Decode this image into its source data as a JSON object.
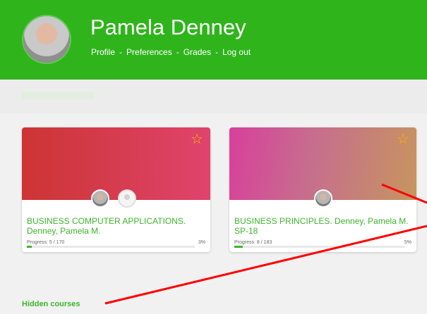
{
  "user": {
    "name": "Pamela Denney",
    "nav": [
      "Profile",
      "Preferences",
      "Grades",
      "Log out"
    ],
    "nav_separator": "-"
  },
  "courses": [
    {
      "title": "BUSINESS COMPUTER APPLICATIONS. Denney, Pamela M.",
      "progress_label": "Progress: 5 / 170",
      "progress_percent_text": "3%",
      "progress_fraction": 0.03,
      "banner_colors": [
        "#cd3434",
        "#e0436d"
      ]
    },
    {
      "title": "BUSINESS PRINCIPLES. Denney, Pamela M. SP-18",
      "progress_label": "Progress: 8 / 183",
      "progress_percent_text": "5%",
      "progress_fraction": 0.05,
      "banner_colors": [
        "#d83f9b",
        "#c7955e"
      ]
    }
  ],
  "hidden_courses_label": "Hidden courses",
  "icons": {
    "favorite": "star-outline-icon",
    "avatar": "user-avatar"
  },
  "colors": {
    "header": "#2fb41c",
    "accent": "#3cb42b",
    "annotation": "#ff0000",
    "star": "#ffb400"
  }
}
